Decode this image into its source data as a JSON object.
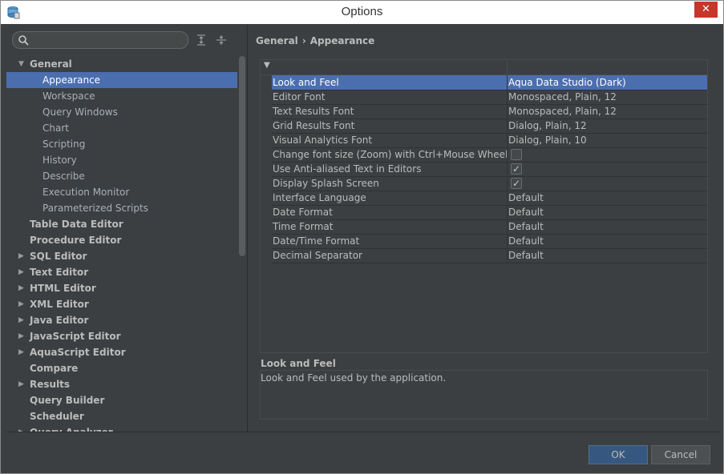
{
  "window": {
    "title": "Options"
  },
  "titlebar": {
    "close_glyph": "✕"
  },
  "search": {
    "placeholder": "",
    "value": ""
  },
  "toolbar": {
    "expand_icon": "expand-all-icon",
    "collapse_icon": "collapse-all-icon"
  },
  "tree": {
    "items": [
      {
        "label": "General",
        "expanded": true,
        "bold": true,
        "has_arrow": true
      },
      {
        "label": "Appearance",
        "child": true,
        "selected": true
      },
      {
        "label": "Workspace",
        "child": true
      },
      {
        "label": "Query Windows",
        "child": true
      },
      {
        "label": "Chart",
        "child": true
      },
      {
        "label": "Scripting",
        "child": true
      },
      {
        "label": "History",
        "child": true
      },
      {
        "label": "Describe",
        "child": true
      },
      {
        "label": "Execution Monitor",
        "child": true
      },
      {
        "label": "Parameterized Scripts",
        "child": true
      },
      {
        "label": "Table Data Editor",
        "bold": true
      },
      {
        "label": "Procedure Editor",
        "bold": true
      },
      {
        "label": "SQL Editor",
        "bold": true,
        "has_arrow": true
      },
      {
        "label": "Text Editor",
        "bold": true,
        "has_arrow": true
      },
      {
        "label": "HTML Editor",
        "bold": true,
        "has_arrow": true
      },
      {
        "label": "XML Editor",
        "bold": true,
        "has_arrow": true
      },
      {
        "label": "Java Editor",
        "bold": true,
        "has_arrow": true
      },
      {
        "label": "JavaScript Editor",
        "bold": true,
        "has_arrow": true
      },
      {
        "label": "AquaScript Editor",
        "bold": true,
        "has_arrow": true
      },
      {
        "label": "Compare",
        "bold": true
      },
      {
        "label": "Results",
        "bold": true,
        "has_arrow": true
      },
      {
        "label": "Query Builder",
        "bold": true
      },
      {
        "label": "Scheduler",
        "bold": true
      },
      {
        "label": "Query Analyzer",
        "bold": true,
        "has_arrow": true
      }
    ]
  },
  "breadcrumb": {
    "parent": "General",
    "separator": "›",
    "current": "Appearance"
  },
  "properties": {
    "rows": [
      {
        "name": "Look and Feel",
        "value": "Aqua Data Studio (Dark)",
        "selected": true
      },
      {
        "name": "Editor Font",
        "value": "Monospaced, Plain, 12"
      },
      {
        "name": "Text Results Font",
        "value": "Monospaced, Plain, 12"
      },
      {
        "name": "Grid Results Font",
        "value": "Dialog, Plain, 12"
      },
      {
        "name": "Visual Analytics Font",
        "value": "Dialog, Plain, 10"
      },
      {
        "name": "Change font size (Zoom) with Ctrl+Mouse Wheel",
        "checkbox": true,
        "checked": false
      },
      {
        "name": "Use Anti-aliased Text in Editors",
        "checkbox": true,
        "checked": true
      },
      {
        "name": "Display Splash Screen",
        "checkbox": true,
        "checked": true
      },
      {
        "name": "Interface Language",
        "value": "Default"
      },
      {
        "name": "Date Format",
        "value": "Default"
      },
      {
        "name": "Time Format",
        "value": "Default"
      },
      {
        "name": "Date/Time Format",
        "value": "Default"
      },
      {
        "name": "Decimal Separator",
        "value": "Default"
      }
    ]
  },
  "description": {
    "title": "Look and Feel",
    "text": "Look and Feel used by the application."
  },
  "buttons": {
    "ok": "OK",
    "cancel": "Cancel"
  },
  "colors": {
    "selection": "#4b6eaf",
    "background": "#3c3f41",
    "close": "#c7362b",
    "ok_button": "#365880"
  }
}
